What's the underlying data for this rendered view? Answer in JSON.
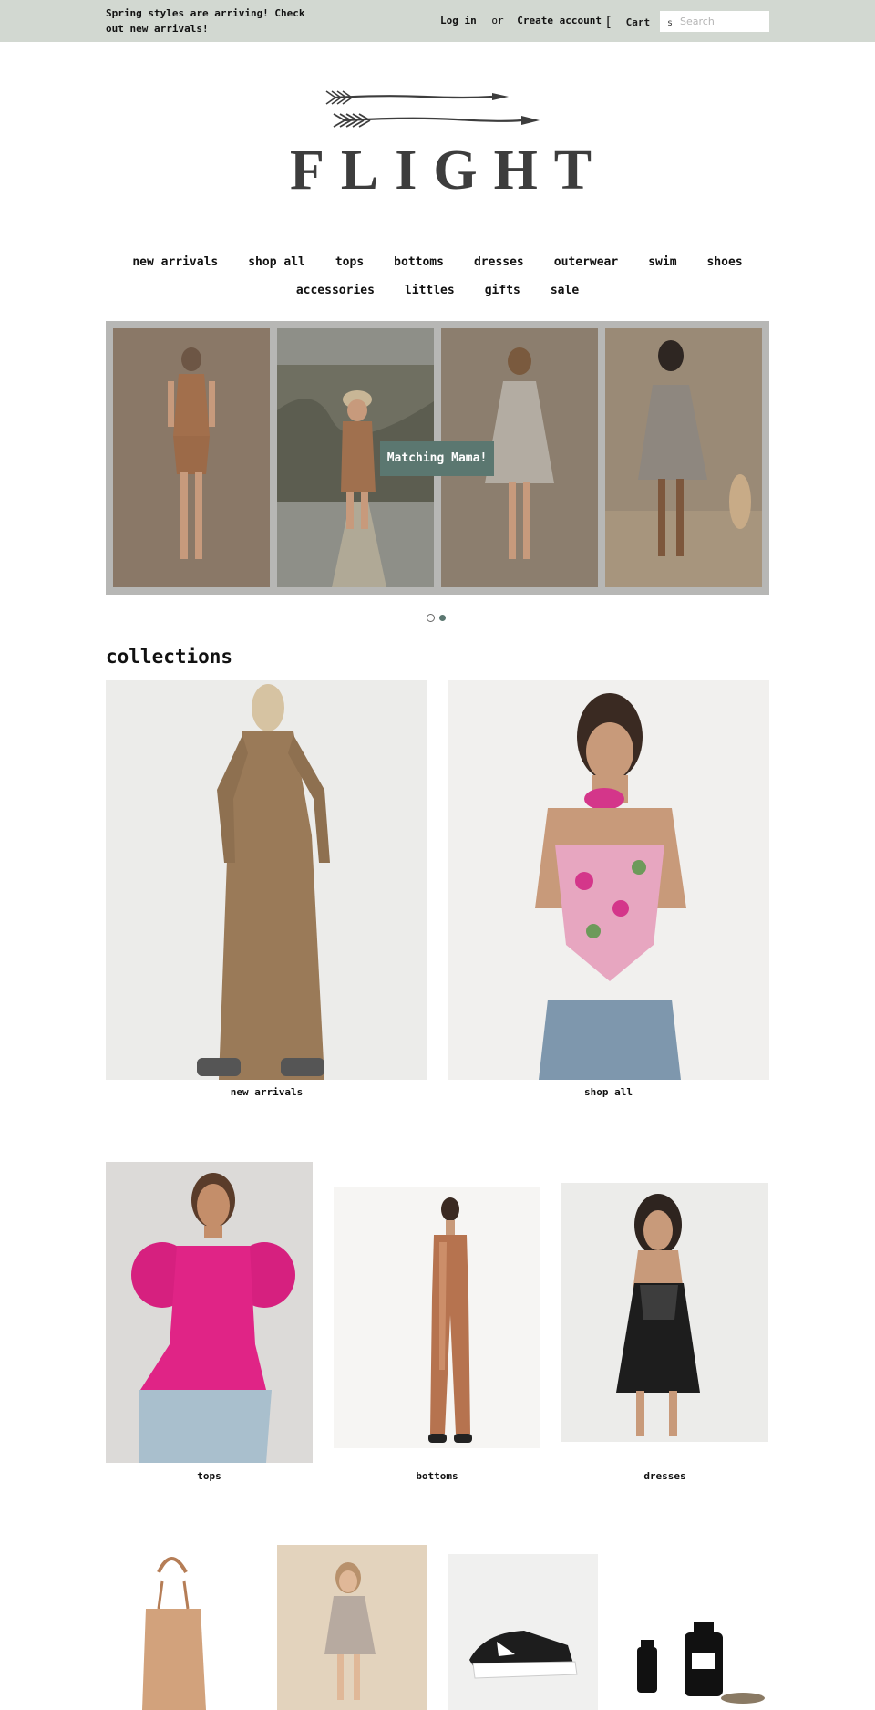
{
  "announcement": {
    "text": "Spring styles are arriving! Check out new arrivals!"
  },
  "account": {
    "login": "Log in",
    "separator": "or",
    "create": "Create account"
  },
  "cart": {
    "label": "Cart",
    "icon": "cart-bracket-icon"
  },
  "search": {
    "placeholder": "Search",
    "icon": "search-icon"
  },
  "logo": {
    "text": "FLIGHT",
    "icon": "arrows-logo"
  },
  "nav": {
    "row1": [
      "new arrivals",
      "shop all",
      "tops",
      "bottoms",
      "dresses",
      "outerwear",
      "swim",
      "shoes"
    ],
    "row2": [
      "accessories",
      "littles",
      "gifts",
      "sale"
    ]
  },
  "slideshow": {
    "caption": "Matching Mama!",
    "active_slide": 2,
    "slide_count": 2
  },
  "collections": {
    "title": "collections",
    "row1": [
      "new arrivals",
      "shop all"
    ],
    "row2": [
      "tops",
      "bottoms",
      "dresses"
    ]
  },
  "colors": {
    "topbar": "#d2d8d1",
    "accent": "#5b7770",
    "logo": "#3d3d3d"
  }
}
